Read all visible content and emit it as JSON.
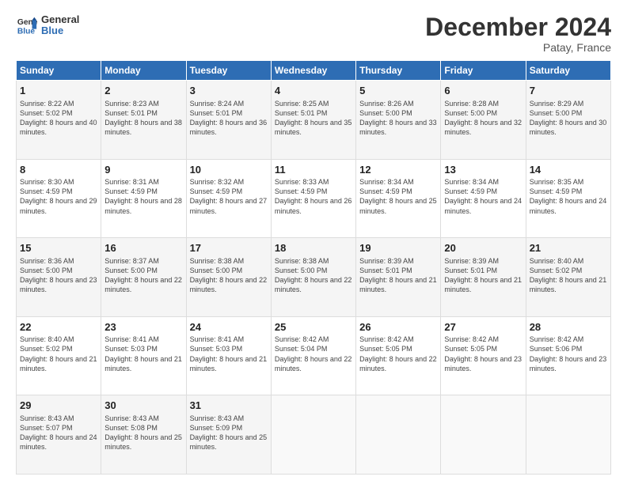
{
  "header": {
    "logo_line1": "General",
    "logo_line2": "Blue",
    "month_title": "December 2024",
    "location": "Patay, France"
  },
  "weekdays": [
    "Sunday",
    "Monday",
    "Tuesday",
    "Wednesday",
    "Thursday",
    "Friday",
    "Saturday"
  ],
  "weeks": [
    [
      {
        "day": "1",
        "sunrise": "Sunrise: 8:22 AM",
        "sunset": "Sunset: 5:02 PM",
        "daylight": "Daylight: 8 hours and 40 minutes."
      },
      {
        "day": "2",
        "sunrise": "Sunrise: 8:23 AM",
        "sunset": "Sunset: 5:01 PM",
        "daylight": "Daylight: 8 hours and 38 minutes."
      },
      {
        "day": "3",
        "sunrise": "Sunrise: 8:24 AM",
        "sunset": "Sunset: 5:01 PM",
        "daylight": "Daylight: 8 hours and 36 minutes."
      },
      {
        "day": "4",
        "sunrise": "Sunrise: 8:25 AM",
        "sunset": "Sunset: 5:01 PM",
        "daylight": "Daylight: 8 hours and 35 minutes."
      },
      {
        "day": "5",
        "sunrise": "Sunrise: 8:26 AM",
        "sunset": "Sunset: 5:00 PM",
        "daylight": "Daylight: 8 hours and 33 minutes."
      },
      {
        "day": "6",
        "sunrise": "Sunrise: 8:28 AM",
        "sunset": "Sunset: 5:00 PM",
        "daylight": "Daylight: 8 hours and 32 minutes."
      },
      {
        "day": "7",
        "sunrise": "Sunrise: 8:29 AM",
        "sunset": "Sunset: 5:00 PM",
        "daylight": "Daylight: 8 hours and 30 minutes."
      }
    ],
    [
      {
        "day": "8",
        "sunrise": "Sunrise: 8:30 AM",
        "sunset": "Sunset: 4:59 PM",
        "daylight": "Daylight: 8 hours and 29 minutes."
      },
      {
        "day": "9",
        "sunrise": "Sunrise: 8:31 AM",
        "sunset": "Sunset: 4:59 PM",
        "daylight": "Daylight: 8 hours and 28 minutes."
      },
      {
        "day": "10",
        "sunrise": "Sunrise: 8:32 AM",
        "sunset": "Sunset: 4:59 PM",
        "daylight": "Daylight: 8 hours and 27 minutes."
      },
      {
        "day": "11",
        "sunrise": "Sunrise: 8:33 AM",
        "sunset": "Sunset: 4:59 PM",
        "daylight": "Daylight: 8 hours and 26 minutes."
      },
      {
        "day": "12",
        "sunrise": "Sunrise: 8:34 AM",
        "sunset": "Sunset: 4:59 PM",
        "daylight": "Daylight: 8 hours and 25 minutes."
      },
      {
        "day": "13",
        "sunrise": "Sunrise: 8:34 AM",
        "sunset": "Sunset: 4:59 PM",
        "daylight": "Daylight: 8 hours and 24 minutes."
      },
      {
        "day": "14",
        "sunrise": "Sunrise: 8:35 AM",
        "sunset": "Sunset: 4:59 PM",
        "daylight": "Daylight: 8 hours and 24 minutes."
      }
    ],
    [
      {
        "day": "15",
        "sunrise": "Sunrise: 8:36 AM",
        "sunset": "Sunset: 5:00 PM",
        "daylight": "Daylight: 8 hours and 23 minutes."
      },
      {
        "day": "16",
        "sunrise": "Sunrise: 8:37 AM",
        "sunset": "Sunset: 5:00 PM",
        "daylight": "Daylight: 8 hours and 22 minutes."
      },
      {
        "day": "17",
        "sunrise": "Sunrise: 8:38 AM",
        "sunset": "Sunset: 5:00 PM",
        "daylight": "Daylight: 8 hours and 22 minutes."
      },
      {
        "day": "18",
        "sunrise": "Sunrise: 8:38 AM",
        "sunset": "Sunset: 5:00 PM",
        "daylight": "Daylight: 8 hours and 22 minutes."
      },
      {
        "day": "19",
        "sunrise": "Sunrise: 8:39 AM",
        "sunset": "Sunset: 5:01 PM",
        "daylight": "Daylight: 8 hours and 21 minutes."
      },
      {
        "day": "20",
        "sunrise": "Sunrise: 8:39 AM",
        "sunset": "Sunset: 5:01 PM",
        "daylight": "Daylight: 8 hours and 21 minutes."
      },
      {
        "day": "21",
        "sunrise": "Sunrise: 8:40 AM",
        "sunset": "Sunset: 5:02 PM",
        "daylight": "Daylight: 8 hours and 21 minutes."
      }
    ],
    [
      {
        "day": "22",
        "sunrise": "Sunrise: 8:40 AM",
        "sunset": "Sunset: 5:02 PM",
        "daylight": "Daylight: 8 hours and 21 minutes."
      },
      {
        "day": "23",
        "sunrise": "Sunrise: 8:41 AM",
        "sunset": "Sunset: 5:03 PM",
        "daylight": "Daylight: 8 hours and 21 minutes."
      },
      {
        "day": "24",
        "sunrise": "Sunrise: 8:41 AM",
        "sunset": "Sunset: 5:03 PM",
        "daylight": "Daylight: 8 hours and 21 minutes."
      },
      {
        "day": "25",
        "sunrise": "Sunrise: 8:42 AM",
        "sunset": "Sunset: 5:04 PM",
        "daylight": "Daylight: 8 hours and 22 minutes."
      },
      {
        "day": "26",
        "sunrise": "Sunrise: 8:42 AM",
        "sunset": "Sunset: 5:05 PM",
        "daylight": "Daylight: 8 hours and 22 minutes."
      },
      {
        "day": "27",
        "sunrise": "Sunrise: 8:42 AM",
        "sunset": "Sunset: 5:05 PM",
        "daylight": "Daylight: 8 hours and 23 minutes."
      },
      {
        "day": "28",
        "sunrise": "Sunrise: 8:42 AM",
        "sunset": "Sunset: 5:06 PM",
        "daylight": "Daylight: 8 hours and 23 minutes."
      }
    ],
    [
      {
        "day": "29",
        "sunrise": "Sunrise: 8:43 AM",
        "sunset": "Sunset: 5:07 PM",
        "daylight": "Daylight: 8 hours and 24 minutes."
      },
      {
        "day": "30",
        "sunrise": "Sunrise: 8:43 AM",
        "sunset": "Sunset: 5:08 PM",
        "daylight": "Daylight: 8 hours and 25 minutes."
      },
      {
        "day": "31",
        "sunrise": "Sunrise: 8:43 AM",
        "sunset": "Sunset: 5:09 PM",
        "daylight": "Daylight: 8 hours and 25 minutes."
      },
      null,
      null,
      null,
      null
    ]
  ]
}
